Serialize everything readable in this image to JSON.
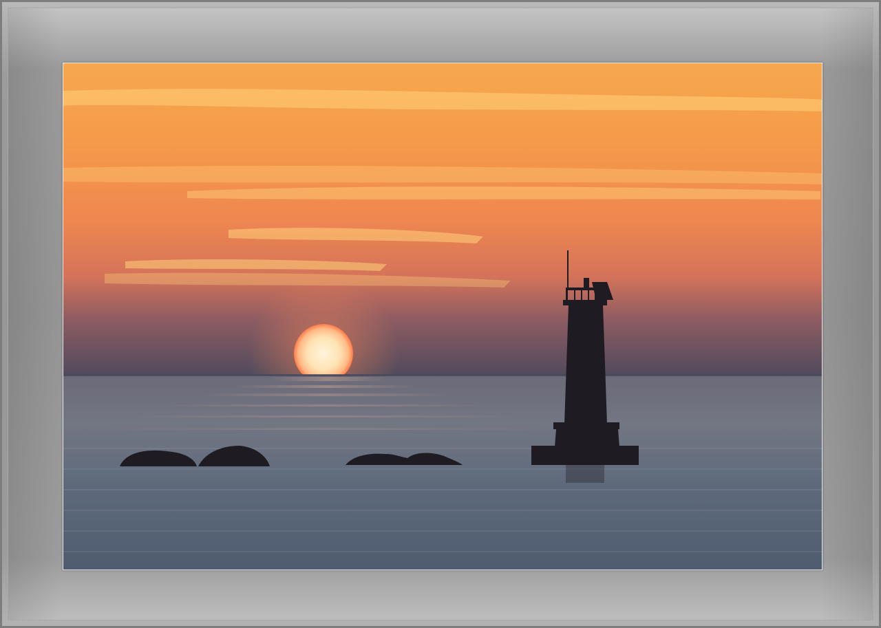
{
  "scene": {
    "subject": "sunset-lighthouse",
    "colors": {
      "frame": "#979797",
      "mat_border": "#e9e9e9",
      "sky_top": "#f6a84e",
      "sky_mid": "#f08a4c",
      "sky_low": "#b56a5a",
      "horizon_haze": "#4f4a5c",
      "sun": "#ffe9c0",
      "sun_glow": "#ff6a3a",
      "sea": "#5a6677",
      "silhouette": "#1f1b22"
    }
  }
}
